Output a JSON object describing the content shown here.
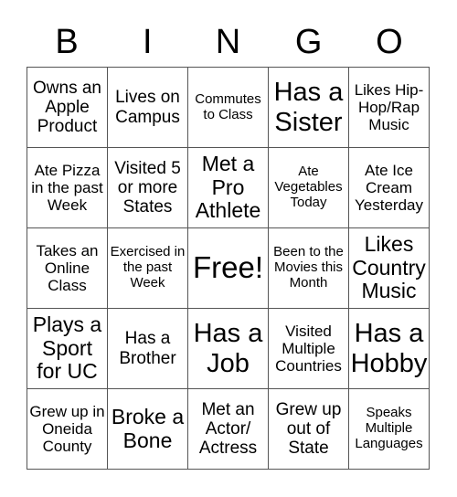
{
  "header": {
    "letters": [
      "B",
      "I",
      "N",
      "G",
      "O"
    ]
  },
  "grid": {
    "rows": [
      [
        "Owns an Apple Product",
        "Lives on Campus",
        "Commutes to Class",
        "Has a Sister",
        "Likes Hip-Hop/Rap Music"
      ],
      [
        "Ate Pizza in the past Week",
        "Visited 5 or more States",
        "Met a Pro Athlete",
        "Ate Vegetables Today",
        "Ate Ice Cream Yesterday"
      ],
      [
        "Takes an Online Class",
        "Exercised in the past Week",
        "Free!",
        "Been to the Movies this Month",
        "Likes Country Music"
      ],
      [
        "Plays a Sport for UC",
        "Has a Brother",
        "Has a Job",
        "Visited Multiple Countries",
        "Has a Hobby"
      ],
      [
        "Grew up in Oneida County",
        "Broke a Bone",
        "Met an Actor/ Actress",
        "Grew up out of State",
        "Speaks Multiple Languages"
      ]
    ]
  }
}
